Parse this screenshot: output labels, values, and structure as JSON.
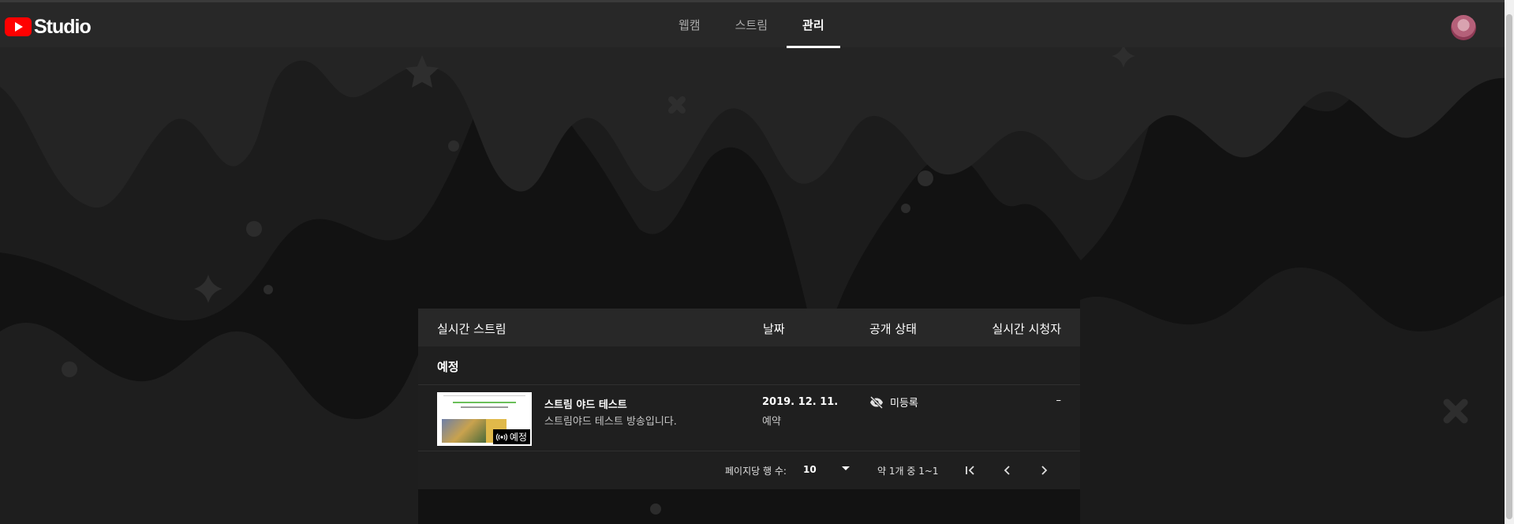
{
  "app": {
    "logo_text": "Studio"
  },
  "nav": {
    "tabs": [
      {
        "label": "웹캠",
        "active": false
      },
      {
        "label": "스트림",
        "active": false
      },
      {
        "label": "관리",
        "active": true
      }
    ]
  },
  "table": {
    "headers": {
      "stream": "실시간 스트림",
      "date": "날짜",
      "visibility": "공개 상태",
      "viewers": "실시간 시청자"
    },
    "section": "예정",
    "rows": [
      {
        "title": "스트림 야드 테스트",
        "description": "스트림야드 테스트 방송입니다.",
        "badge": "예정",
        "date": "2019. 12. 11.",
        "date_status": "예약",
        "visibility": "미등록",
        "viewers": "–"
      }
    ],
    "pager": {
      "rows_per_page_label": "페이지당 행 수:",
      "rows_per_page": "10",
      "range": "약 1개 중 1~1"
    }
  },
  "colors": {
    "brand_red": "#ff0000",
    "topbar": "#282828",
    "background": "#121212",
    "card": "#1f1f1f"
  },
  "icons": [
    "youtube-play-icon",
    "live-broadcast-icon",
    "eye-off-icon",
    "dropdown-arrow-icon",
    "first-page-icon",
    "prev-page-icon",
    "next-page-icon"
  ]
}
